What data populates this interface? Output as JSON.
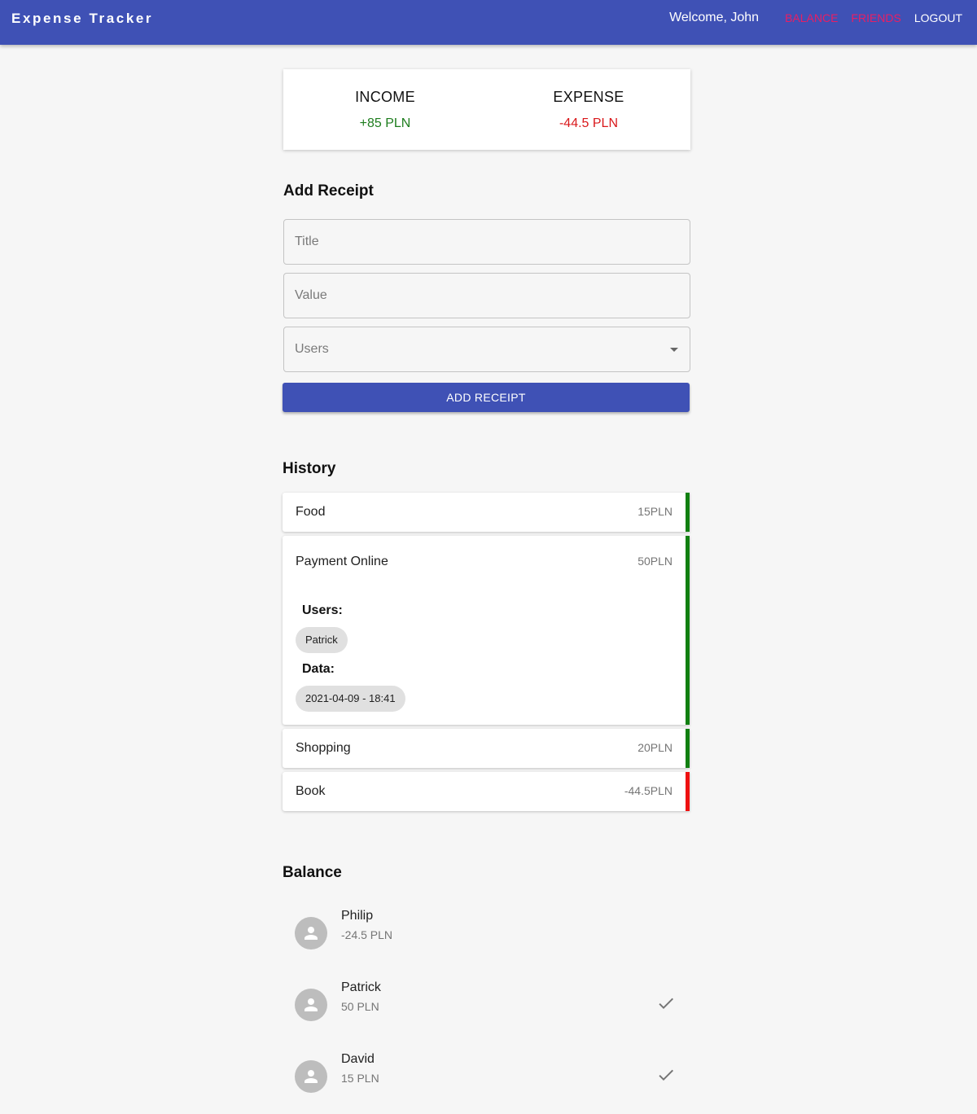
{
  "app": {
    "title": "Expense Tracker",
    "welcome": "Welcome, John",
    "nav": [
      {
        "label": "BALANCE"
      },
      {
        "label": "FRIENDS"
      },
      {
        "label": "LOGOUT"
      }
    ]
  },
  "summary": {
    "income_label": "INCOME",
    "income_value": "+85 PLN",
    "expense_label": "EXPENSE",
    "expense_value": "-44.5 PLN"
  },
  "add_receipt": {
    "heading": "Add Receipt",
    "title_placeholder": "Title",
    "value_placeholder": "Value",
    "users_placeholder": "Users",
    "button_label": "ADD RECEIPT"
  },
  "history": {
    "heading": "History",
    "items": [
      {
        "title": "Food",
        "amount": "15PLN"
      },
      {
        "title": "Payment Online",
        "amount": "50PLN",
        "users_label": "Users:",
        "user": "Patrick",
        "date_label": "Data:",
        "date": "2021-04-09 - 18:41"
      },
      {
        "title": "Shopping",
        "amount": "20PLN"
      },
      {
        "title": "Book",
        "amount": "-44.5PLN"
      }
    ]
  },
  "balance": {
    "heading": "Balance",
    "people": [
      {
        "name": "Philip",
        "amount": "-24.5 PLN",
        "settled": false
      },
      {
        "name": "Patrick",
        "amount": "50 PLN",
        "settled": true
      },
      {
        "name": "David",
        "amount": "15 PLN",
        "settled": true
      }
    ]
  },
  "colors": {
    "primary": "#3f51b5",
    "accent_pink": "#e91e63",
    "income_green": "#1e7d1e",
    "expense_red": "#d9181b",
    "positive_bar": "#118011",
    "negative_bar": "#ee1111"
  },
  "icons": {
    "avatar": "person-icon",
    "settled": "check-icon",
    "select": "arrow-drop-down-icon"
  }
}
